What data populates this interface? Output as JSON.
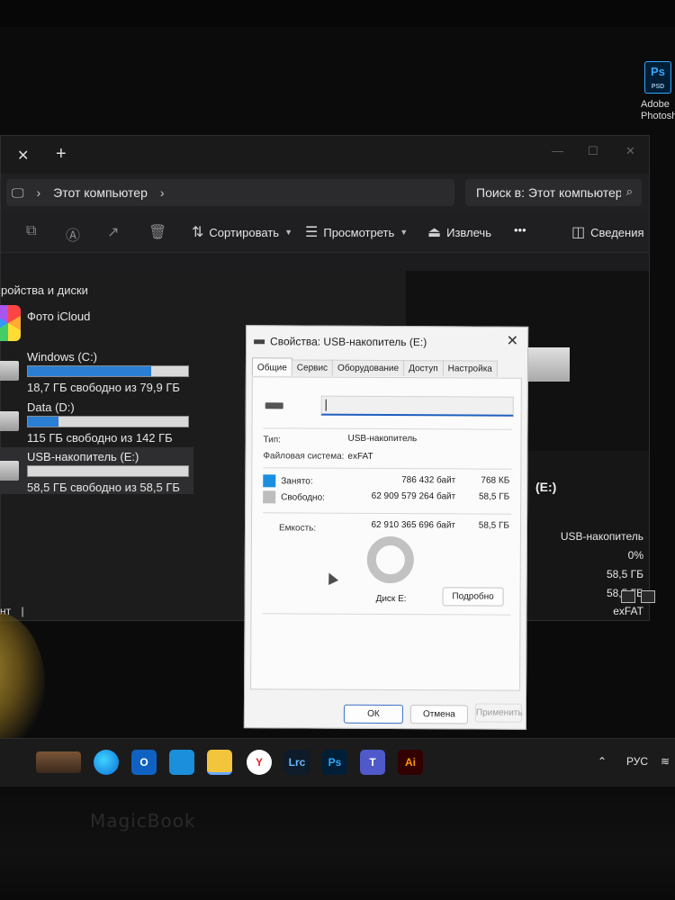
{
  "desktop": {
    "icon": {
      "badge": "Ps",
      "ext": "PSD",
      "label_line1": "Adobe",
      "label_line2": "Photosho"
    }
  },
  "explorer": {
    "address": "Этот компьютер",
    "search_placeholder": "Поиск в: Этот компьютер",
    "toolbar": {
      "sort": "Сортировать",
      "view": "Просмотреть",
      "eject": "Извлечь",
      "more": "•••",
      "details": "Сведения"
    },
    "section_title": "ройства и диски",
    "icloud": "Фото iCloud",
    "drives": [
      {
        "name": "Windows (C:)",
        "free": "18,7 ГБ свободно из 79,9 ГБ",
        "used_fraction": 0.77
      },
      {
        "name": "Data (D:)",
        "free": "115 ГБ свободно из 142 ГБ",
        "used_fraction": 0.19
      },
      {
        "name": "USB-накопитель (E:)",
        "free": "58,5 ГБ свободно из 58,5 ГБ",
        "used_fraction": 0.0
      }
    ],
    "details_pane": {
      "drive_letter": "(E:)",
      "values": [
        "USB-накопитель",
        "0%",
        "58,5 ГБ",
        "58,5 ГБ",
        "exFAT"
      ]
    },
    "status_left": "нт"
  },
  "dialog": {
    "title": "Свойства: USB-накопитель (E:)",
    "tabs": [
      "Общие",
      "Сервис",
      "Оборудование",
      "Доступ",
      "Настройка"
    ],
    "type_label": "Тип:",
    "type_value": "USB-накопитель",
    "fs_label": "Файловая система:",
    "fs_value": "exFAT",
    "used_label": "Занято:",
    "used_bytes": "786 432 байт",
    "used_short": "768 КБ",
    "free_label": "Свободно:",
    "free_bytes": "62 909 579 264 байт",
    "free_short": "58,5 ГБ",
    "capacity_label": "Емкость:",
    "capacity_bytes": "62 910 365 696 байт",
    "capacity_short": "58,5 ГБ",
    "disk_label": "Диск E:",
    "details_button": "Подробно",
    "ok": "ОК",
    "cancel": "Отмена",
    "apply": "Применить",
    "colors": {
      "used": "#1a8fe0",
      "free": "#bdbdbd"
    }
  },
  "taskbar": {
    "apps": [
      "edge-icon",
      "outlook-icon",
      "monitor-icon",
      "file-explorer-icon",
      "yandex-icon",
      "Lrc",
      "Ps",
      "teams-icon",
      "Ai"
    ],
    "lrc": "Lrc",
    "ps": "Ps",
    "ai": "Ai",
    "lang": "РУС"
  }
}
